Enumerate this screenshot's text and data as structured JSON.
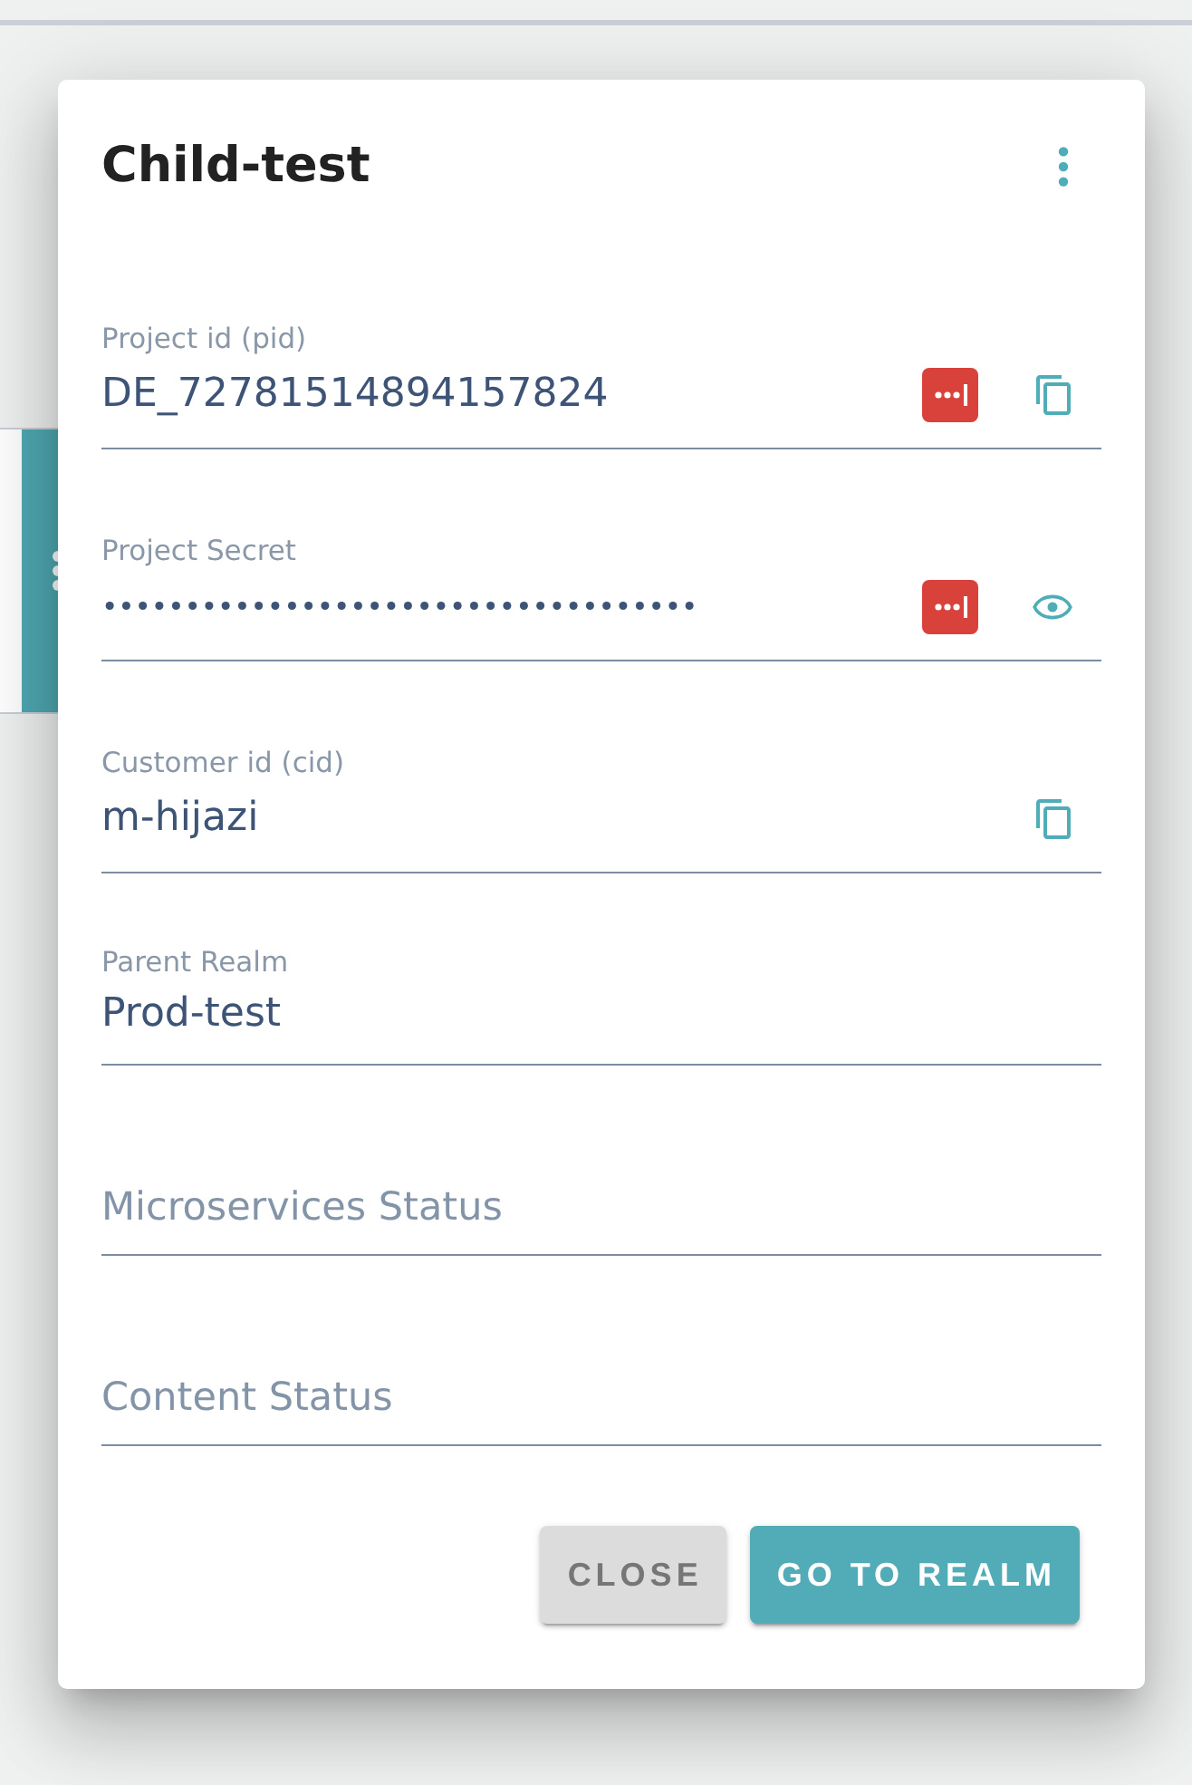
{
  "dialog": {
    "title": "Child-test",
    "fields": [
      {
        "label": "Project id (pid)",
        "value": "DE_72781514894157824",
        "kind": "copy",
        "autofill": true
      },
      {
        "label": "Project Secret",
        "value": "••••••••••••••••••••••••••••••••••••",
        "kind": "secret",
        "autofill": true
      },
      {
        "label": "Customer id (cid)",
        "value": "m-hijazi",
        "kind": "copy",
        "autofill": false
      },
      {
        "label": "Parent Realm",
        "value": "Prod-test",
        "kind": "plain",
        "autofill": false
      },
      {
        "placeholder": "Microservices Status",
        "kind": "empty",
        "autofill": false
      },
      {
        "placeholder": "Content Status",
        "kind": "empty",
        "autofill": false
      }
    ],
    "buttons": [
      {
        "label": "CLOSE",
        "kind": "secondary"
      },
      {
        "label": "GO TO REALM",
        "kind": "primary"
      }
    ]
  }
}
